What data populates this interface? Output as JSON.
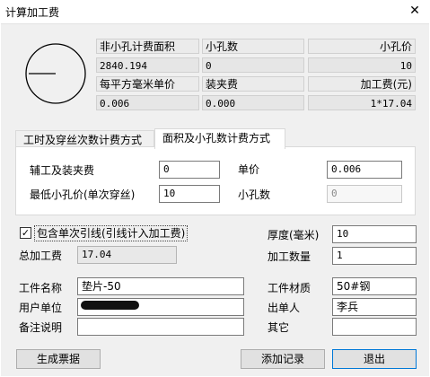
{
  "window": {
    "title": "计算加工费"
  },
  "info_grid": {
    "h1": "非小孔计费面积",
    "h2": "小孔数",
    "h3": "小孔价",
    "v1": "2840.194",
    "v2": "0",
    "v3": "10",
    "h4": "每平方毫米单价",
    "h5": "装夹费",
    "h6": "加工费(元)",
    "v4": "0.006",
    "v5": "0.000",
    "v6": "1*17.04"
  },
  "tabs": [
    {
      "label": "工时及穿丝次数计费方式",
      "active": false
    },
    {
      "label": "面积及小孔数计费方式",
      "active": true
    }
  ],
  "tab_panel": {
    "aux_fee_label": "辅工及装夹费",
    "aux_fee_value": "0",
    "unit_price_label": "单价",
    "unit_price_value": "0.006",
    "min_hole_price_label": "最低小孔价(单次穿丝)",
    "min_hole_price_value": "10",
    "hole_count_label": "小孔数",
    "hole_count_value": "0"
  },
  "form": {
    "include_lead_label": "包含单次引线(引线计入加工费)",
    "include_lead_checked": true,
    "thickness_label": "厚度(毫米)",
    "thickness_value": "10",
    "total_label": "总加工费",
    "total_value": "17.04",
    "quantity_label": "加工数量",
    "quantity_value": "1",
    "part_name_label": "工件名称",
    "part_name_value": "垫片-50",
    "material_label": "工件材质",
    "material_value": "50#钢",
    "user_unit_label": "用户单位",
    "user_unit_value": "",
    "issuer_label": "出单人",
    "issuer_value": "李兵",
    "remark_label": "备注说明",
    "remark_value": "",
    "other_label": "其它",
    "other_value": ""
  },
  "buttons": {
    "generate": "生成票据",
    "add_record": "添加记录",
    "exit": "退出"
  }
}
